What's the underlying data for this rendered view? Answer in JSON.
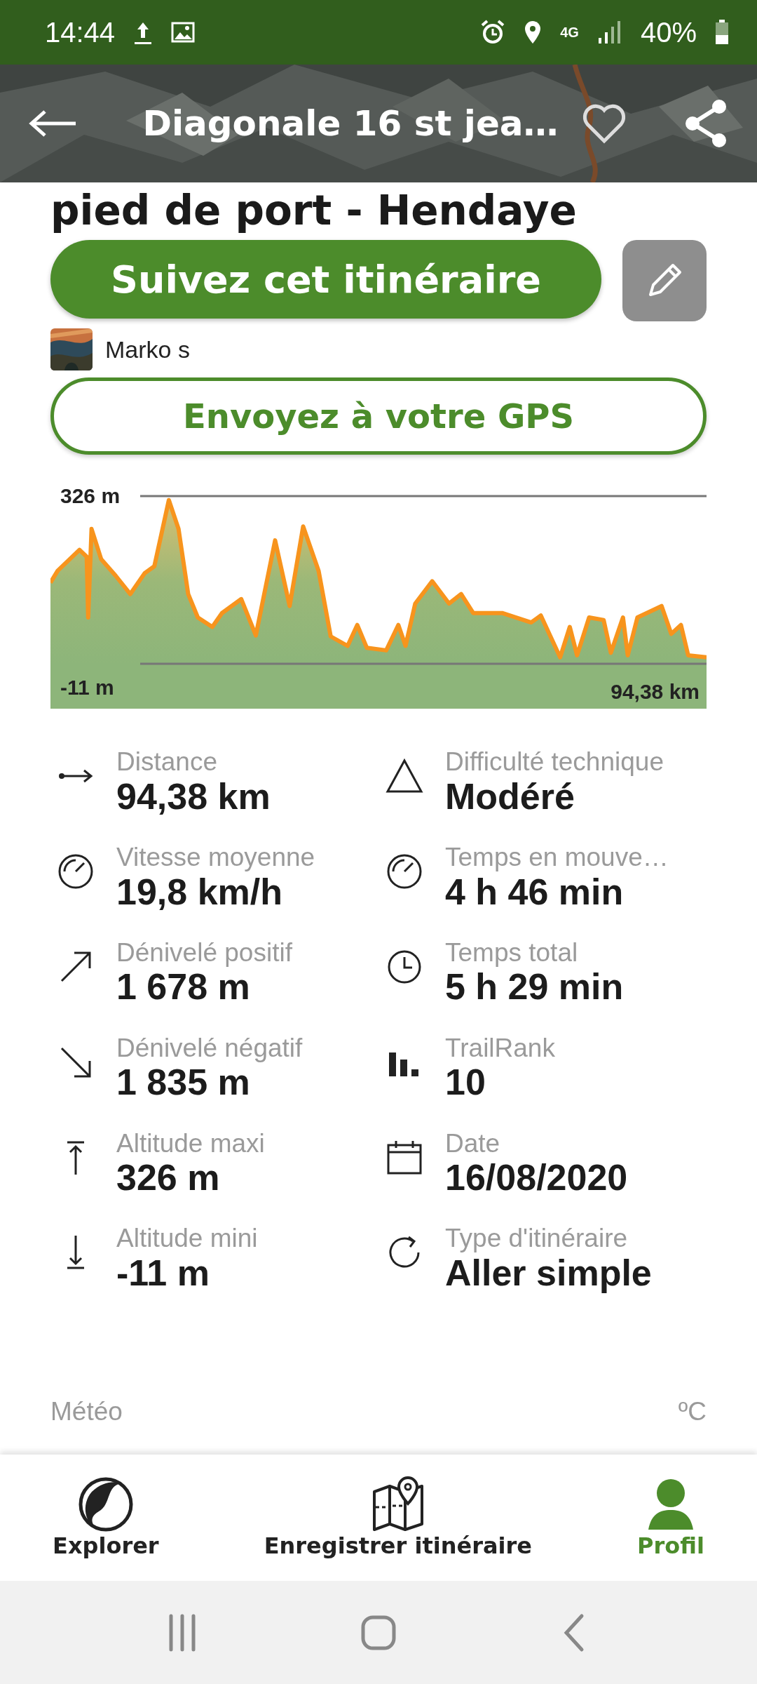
{
  "status_bar": {
    "time": "14:44",
    "network": "4G",
    "battery": "40%"
  },
  "header": {
    "title": "Diagonale 16 st jea…",
    "favorite": false
  },
  "route_title": "pied de port - Hendaye",
  "follow_button": "Suivez cet itinéraire",
  "author": {
    "name": "Marko s"
  },
  "gps_button": "Envoyez à votre GPS",
  "elevation": {
    "max_label": "326 m",
    "min_label": "-11 m",
    "distance_label": "94,38 km"
  },
  "stats": [
    {
      "kind": "distance",
      "label": "Distance",
      "value": "94,38 km"
    },
    {
      "kind": "difficulty",
      "label": "Difficulté technique",
      "value": "Modéré"
    },
    {
      "kind": "speed",
      "label": "Vitesse moyenne",
      "value": "19,8 km/h"
    },
    {
      "kind": "speed",
      "label": "Temps en mouve…",
      "value": "4 h 46 min"
    },
    {
      "kind": "ascent",
      "label": "Dénivelé positif",
      "value": "1 678 m"
    },
    {
      "kind": "clock",
      "label": "Temps total",
      "value": "5 h 29 min"
    },
    {
      "kind": "descent",
      "label": "Dénivelé négatif",
      "value": "1 835 m"
    },
    {
      "kind": "rank",
      "label": "TrailRank",
      "value": "10"
    },
    {
      "kind": "max",
      "label": "Altitude maxi",
      "value": "326 m"
    },
    {
      "kind": "date",
      "label": "Date",
      "value": "16/08/2020"
    },
    {
      "kind": "min",
      "label": "Altitude mini",
      "value": "-11 m"
    },
    {
      "kind": "loop",
      "label": "Type d'itinéraire",
      "value": "Aller simple"
    }
  ],
  "weather": {
    "title": "Météo",
    "unit": "ºC"
  },
  "nav": [
    {
      "kind": "explore",
      "label": "Explorer",
      "selected": false
    },
    {
      "kind": "record",
      "label": "Enregistrer itinéraire",
      "selected": false
    },
    {
      "kind": "profile",
      "label": "Profil",
      "selected": true
    }
  ]
}
